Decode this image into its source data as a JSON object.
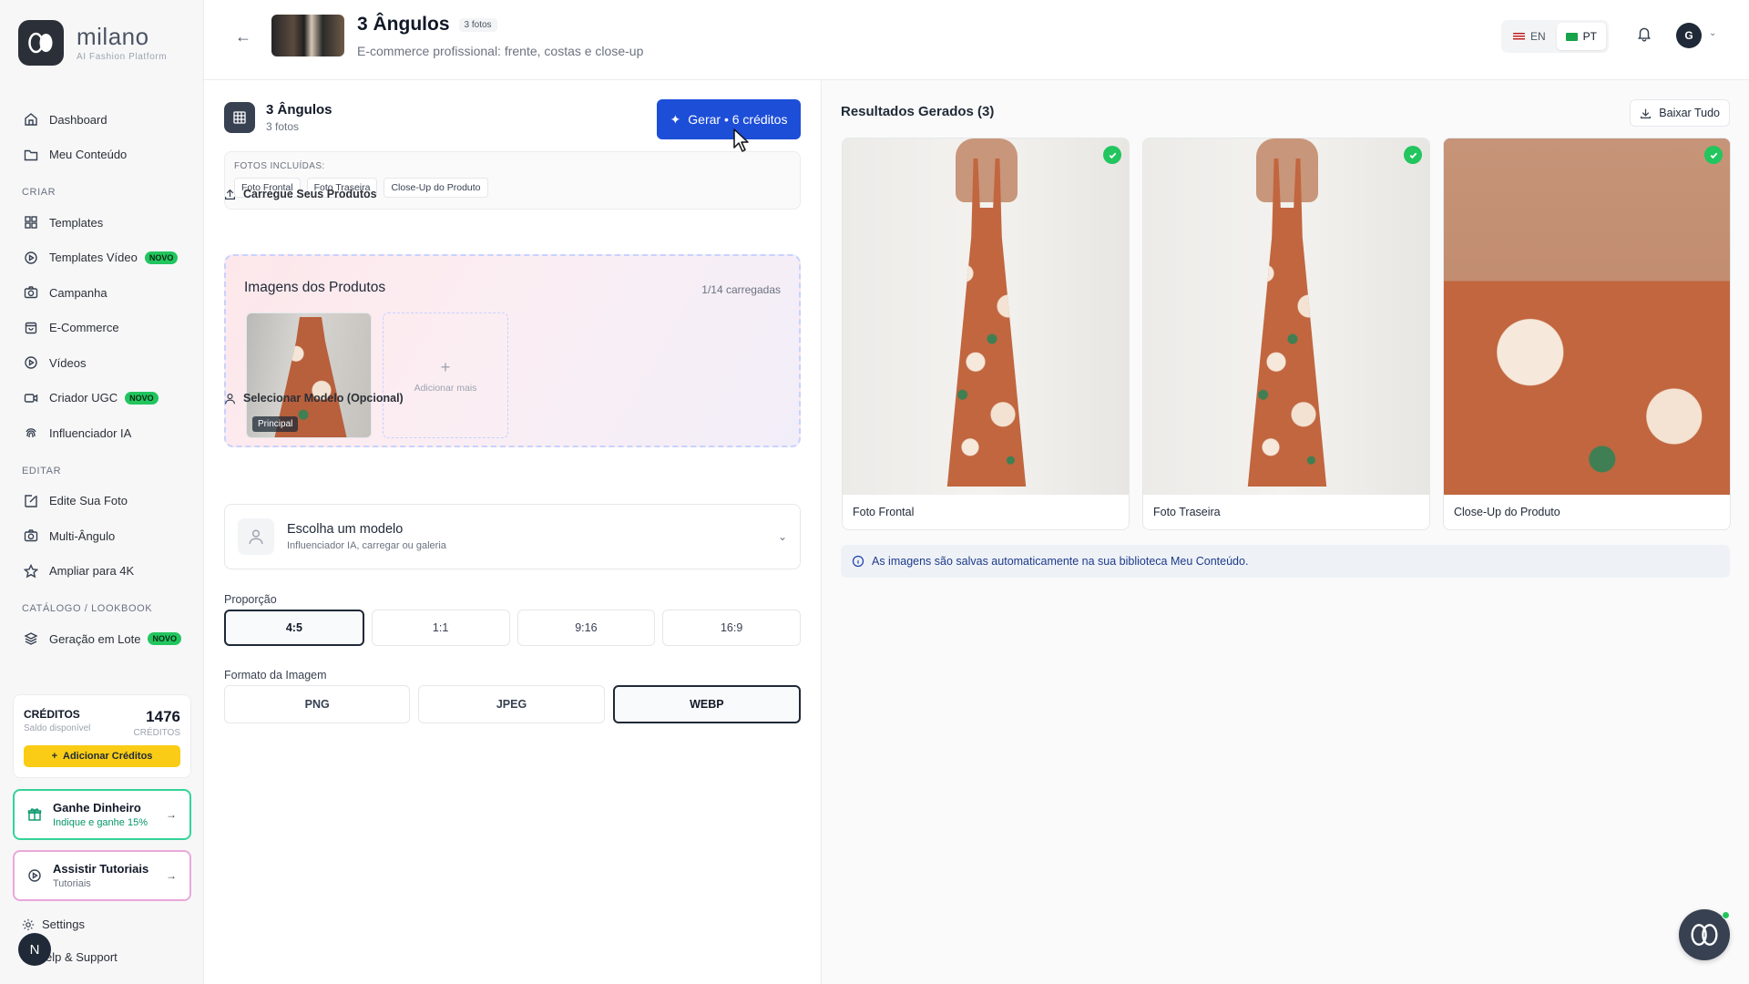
{
  "brand": {
    "name": "milano",
    "tagline": "AI Fashion Platform"
  },
  "sidebar": {
    "top_items": [
      {
        "label": "Dashboard",
        "icon": "home-icon"
      },
      {
        "label": "Meu Conteúdo",
        "icon": "folder-icon"
      }
    ],
    "sections": [
      {
        "title": "CRIAR",
        "items": [
          {
            "label": "Templates",
            "icon": "grid-icon"
          },
          {
            "label": "Templates Vídeo",
            "icon": "play-circle-icon",
            "badge": "NOVO"
          },
          {
            "label": "Campanha",
            "icon": "camera-icon"
          },
          {
            "label": "E-Commerce",
            "icon": "shopping-bag-icon"
          },
          {
            "label": "Vídeos",
            "icon": "play-circle-icon"
          },
          {
            "label": "Criador UGC",
            "icon": "video-icon",
            "badge": "NOVO"
          },
          {
            "label": "Influenciador IA",
            "icon": "fingerprint-icon"
          }
        ]
      },
      {
        "title": "EDITAR",
        "items": [
          {
            "label": "Edite Sua Foto",
            "icon": "edit-icon"
          },
          {
            "label": "Multi-Ângulo",
            "icon": "camera-icon"
          },
          {
            "label": "Ampliar para 4K",
            "icon": "star-icon"
          }
        ]
      },
      {
        "title": "CATÁLOGO / LOOKBOOK",
        "items": [
          {
            "label": "Geração em Lote",
            "icon": "layers-icon",
            "badge": "NOVO"
          }
        ]
      }
    ],
    "credits": {
      "title": "CRÉDITOS",
      "subtitle": "Saldo disponível",
      "amount": "1476",
      "unit": "CRÉDITOS",
      "add_label": "Adicionar Créditos"
    },
    "earn": {
      "title": "Ganhe Dinheiro",
      "subtitle": "Indique e ganhe 15%"
    },
    "tutorials": {
      "title": "Assistir Tutoriais",
      "subtitle": "Tutoriais"
    },
    "settings_label": "Settings",
    "help_label": "elp & Support",
    "user_initial": "N"
  },
  "header": {
    "title": "3 Ângulos",
    "count_badge": "3 fotos",
    "subtitle": "E-commerce profissional: frente, costas e close-up",
    "languages": [
      {
        "code": "EN",
        "active": false
      },
      {
        "code": "PT",
        "active": true
      }
    ],
    "user_initial": "G"
  },
  "config": {
    "title": "3 Ângulos",
    "subtitle": "3 fotos",
    "generate_label": "Gerar • 6 créditos",
    "included_label": "FOTOS INCLUÍDAS:",
    "included": [
      "Foto Frontal",
      "Foto Traseira",
      "Close-Up do Produto"
    ],
    "upload_section": "Carregue Seus Produtos",
    "upload_title": "Imagens dos Produtos",
    "upload_count": "1/14 carregadas",
    "principal_tag": "Principal",
    "add_more": "Adicionar mais",
    "model_section": "Selecionar Modelo (Opcional)",
    "model_title": "Escolha um modelo",
    "model_subtitle": "Influenciador IA, carregar ou galeria",
    "ratio_label": "Proporção",
    "ratios": [
      "4:5",
      "1:1",
      "9:16",
      "16:9"
    ],
    "ratio_selected": "4:5",
    "format_label": "Formato da Imagem",
    "formats": [
      "PNG",
      "JPEG",
      "WEBP"
    ],
    "format_selected": "WEBP"
  },
  "results": {
    "title": "Resultados Gerados (3)",
    "download_all": "Baixar Tudo",
    "items": [
      {
        "caption": "Foto Frontal"
      },
      {
        "caption": "Foto Traseira"
      },
      {
        "caption": "Close-Up do Produto"
      }
    ],
    "info": "As imagens são salvas automaticamente na sua biblioteca Meu Conteúdo."
  },
  "colors": {
    "primary": "#1d4ed8",
    "success": "#22c55e",
    "credit_button": "#facc15",
    "badge_new": "#22c55e"
  }
}
